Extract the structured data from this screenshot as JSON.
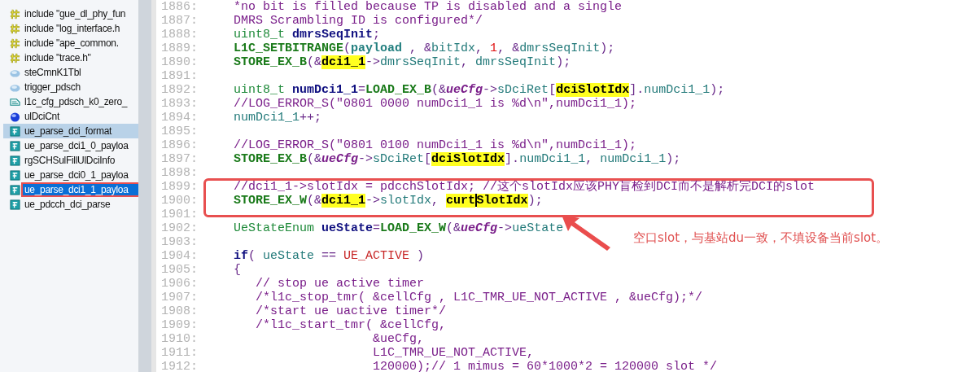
{
  "sidebar": {
    "items": [
      {
        "kind": "include",
        "text": "include \"gue_dl_phy_fun",
        "hovered": false,
        "selected": false
      },
      {
        "kind": "include",
        "text": "include \"log_interface.h",
        "hovered": false,
        "selected": false
      },
      {
        "kind": "include",
        "text": "include \"ape_common.",
        "hovered": false,
        "selected": false
      },
      {
        "kind": "include",
        "text": "include \"trace.h\"",
        "hovered": false,
        "selected": false
      },
      {
        "kind": "variable",
        "text": "steCmnK1Tbl",
        "hovered": false,
        "selected": false
      },
      {
        "kind": "variable",
        "text": "trigger_pdsch",
        "hovered": false,
        "selected": false
      },
      {
        "kind": "struct",
        "text": "l1c_cfg_pdsch_k0_zero_",
        "hovered": false,
        "selected": false
      },
      {
        "kind": "global",
        "text": "ulDciCnt",
        "hovered": false,
        "selected": false
      },
      {
        "kind": "function",
        "text": "ue_parse_dci_format",
        "hovered": true,
        "selected": false
      },
      {
        "kind": "function",
        "text": "ue_parse_dci1_0_payloa",
        "hovered": false,
        "selected": false
      },
      {
        "kind": "function",
        "text": "rgSCHSulFillUlDciInfo",
        "hovered": false,
        "selected": false
      },
      {
        "kind": "function",
        "text": "ue_parse_dci0_1_payloa",
        "hovered": false,
        "selected": false
      },
      {
        "kind": "function",
        "text": "ue_parse_dci1_1_payloa",
        "hovered": false,
        "selected": true
      },
      {
        "kind": "function",
        "text": "ue_pdcch_dci_parse",
        "hovered": false,
        "selected": false
      }
    ]
  },
  "editor": {
    "lines": [
      {
        "number": "1886:",
        "tokens": [
          {
            "kind": "c",
            "text": "*no bit is filled because TP is disabled and a single"
          }
        ]
      },
      {
        "number": "1887:",
        "tokens": [
          {
            "kind": "c",
            "text": "DMRS Scrambling ID is configured*/"
          }
        ]
      },
      {
        "number": "1888:",
        "tokens": [
          {
            "kind": "t",
            "text": "uint8_t "
          },
          {
            "kind": "v",
            "text": "dmrsSeqInit"
          },
          {
            "kind": "o",
            "text": ";"
          }
        ]
      },
      {
        "number": "1889:",
        "tokens": [
          {
            "kind": "m",
            "text": "L1C_SETBITRANGE"
          },
          {
            "kind": "o",
            "text": "("
          },
          {
            "kind": "p",
            "text": "payload"
          },
          {
            "kind": "o",
            "text": " , &"
          },
          {
            "kind": "x",
            "text": "bitIdx"
          },
          {
            "kind": "o",
            "text": ", "
          },
          {
            "kind": "n",
            "text": "1"
          },
          {
            "kind": "o",
            "text": ", &"
          },
          {
            "kind": "x",
            "text": "dmrsSeqInit"
          },
          {
            "kind": "o",
            "text": ");"
          }
        ]
      },
      {
        "number": "1890:",
        "tokens": [
          {
            "kind": "m",
            "text": "STORE_EX_B"
          },
          {
            "kind": "o",
            "text": "(&"
          },
          {
            "kind": "h",
            "text": "dci1_1"
          },
          {
            "kind": "o",
            "text": "->"
          },
          {
            "kind": "x",
            "text": "dmrsSeqInit"
          },
          {
            "kind": "o",
            "text": ", "
          },
          {
            "kind": "x",
            "text": "dmrsSeqInit"
          },
          {
            "kind": "o",
            "text": ");"
          }
        ]
      },
      {
        "number": "1891:"
      },
      {
        "number": "1892:",
        "tokens": [
          {
            "kind": "t",
            "text": "uint8_t "
          },
          {
            "kind": "v",
            "text": "numDci1_1"
          },
          {
            "kind": "o",
            "text": "="
          },
          {
            "kind": "m",
            "text": "LOAD_EX_B"
          },
          {
            "kind": "o",
            "text": "(&"
          },
          {
            "kind": "pi",
            "text": "ueCfg"
          },
          {
            "kind": "o",
            "text": "->"
          },
          {
            "kind": "x",
            "text": "sDciRet"
          },
          {
            "kind": "o",
            "text": "["
          },
          {
            "kind": "h",
            "text": "dciSlotIdx"
          },
          {
            "kind": "o",
            "text": "]."
          },
          {
            "kind": "x",
            "text": "numDci1_1"
          },
          {
            "kind": "o",
            "text": ");"
          }
        ]
      },
      {
        "number": "1893:",
        "tokens": [
          {
            "kind": "c",
            "text": "//LOG_ERROR_S(\"0801 0000 numDci1_1 is %d\\n\",numDci1_1);"
          }
        ]
      },
      {
        "number": "1894:",
        "tokens": [
          {
            "kind": "x",
            "text": "numDci1_1"
          },
          {
            "kind": "o",
            "text": "++;"
          }
        ]
      },
      {
        "number": "1895:"
      },
      {
        "number": "1896:",
        "tokens": [
          {
            "kind": "c",
            "text": "//LOG_ERROR_S(\"0801 0100 numDci1_1 is %d\\n\",numDci1_1);"
          }
        ]
      },
      {
        "number": "1897:",
        "tokens": [
          {
            "kind": "m",
            "text": "STORE_EX_B"
          },
          {
            "kind": "o",
            "text": "(&"
          },
          {
            "kind": "pi",
            "text": "ueCfg"
          },
          {
            "kind": "o",
            "text": "->"
          },
          {
            "kind": "x",
            "text": "sDciRet"
          },
          {
            "kind": "o",
            "text": "["
          },
          {
            "kind": "h",
            "text": "dciSlotIdx"
          },
          {
            "kind": "o",
            "text": "]."
          },
          {
            "kind": "x",
            "text": "numDci1_1"
          },
          {
            "kind": "o",
            "text": ", "
          },
          {
            "kind": "x",
            "text": "numDci1_1"
          },
          {
            "kind": "o",
            "text": ");"
          }
        ]
      },
      {
        "number": "1898:"
      },
      {
        "number": "1899:",
        "tokens": [
          {
            "kind": "c",
            "text": "//dci1_1->slotIdx = pdcchSlotIdx; //这个slotIdx应该PHY盲检到DCI而不是解析完DCI的slot"
          }
        ]
      },
      {
        "number": "1900:",
        "tokens": [
          {
            "kind": "m",
            "text": "STORE_EX_W"
          },
          {
            "kind": "o",
            "text": "(&"
          },
          {
            "kind": "h",
            "text": "dci1_1"
          },
          {
            "kind": "o",
            "text": "->"
          },
          {
            "kind": "x",
            "text": "slotIdx"
          },
          {
            "kind": "o",
            "text": ", "
          },
          {
            "kind": "h",
            "text": "curt"
          },
          {
            "kind": "caret"
          },
          {
            "kind": "h",
            "text": "SlotIdx"
          },
          {
            "kind": "o",
            "text": ");"
          }
        ]
      },
      {
        "number": "1901:"
      },
      {
        "number": "1902:",
        "tokens": [
          {
            "kind": "t",
            "text": "UeStateEnum "
          },
          {
            "kind": "v",
            "text": "ueState"
          },
          {
            "kind": "o",
            "text": "="
          },
          {
            "kind": "m",
            "text": "LOAD_EX_W"
          },
          {
            "kind": "o",
            "text": "(&"
          },
          {
            "kind": "pi",
            "text": "ueCfg"
          },
          {
            "kind": "o",
            "text": "->"
          },
          {
            "kind": "x",
            "text": "ueState"
          }
        ]
      },
      {
        "number": "1903:"
      },
      {
        "number": "1904:",
        "tokens": [
          {
            "kind": "k",
            "text": "if"
          },
          {
            "kind": "o",
            "text": "( "
          },
          {
            "kind": "x",
            "text": "ueState"
          },
          {
            "kind": "o",
            "text": " == "
          },
          {
            "kind": "e",
            "text": "UE_ACTIVE"
          },
          {
            "kind": "o",
            "text": " )"
          }
        ]
      },
      {
        "number": "1905:",
        "tokens": [
          {
            "kind": "o",
            "text": "{"
          }
        ]
      },
      {
        "number": "1906:",
        "tokens": [
          {
            "kind": "c",
            "text": "   // stop ue active timer"
          }
        ]
      },
      {
        "number": "1907:",
        "tokens": [
          {
            "kind": "c",
            "text": "   /*l1c_stop_tmr( &cellCfg , L1C_TMR_UE_NOT_ACTIVE , &ueCfg);*/"
          }
        ]
      },
      {
        "number": "1908:",
        "tokens": [
          {
            "kind": "c",
            "text": "   /*start ue uactive timer*/"
          }
        ]
      },
      {
        "number": "1909:",
        "tokens": [
          {
            "kind": "c",
            "text": "   /*l1c_start_tmr( &cellCfg,"
          }
        ]
      },
      {
        "number": "1910:",
        "tokens": [
          {
            "kind": "c",
            "text": "                   &ueCfg,"
          }
        ]
      },
      {
        "number": "1911:",
        "tokens": [
          {
            "kind": "c",
            "text": "                   L1C_TMR_UE_NOT_ACTIVE,"
          }
        ]
      },
      {
        "number": "1912:",
        "tokens": [
          {
            "kind": "c",
            "text": "                   120000);// 1 mimus = 60*1000*2 = 120000 slot */"
          }
        ]
      }
    ]
  },
  "annotation": {
    "note": "空口slot，与基站du一致，不填设备当前slot。"
  }
}
